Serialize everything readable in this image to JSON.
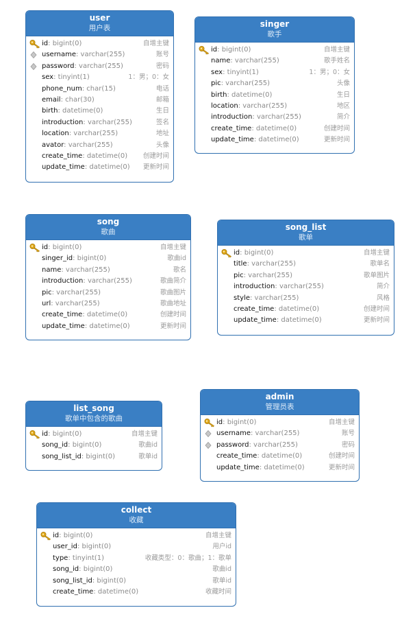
{
  "colors": {
    "header_bg": "#3a7fc4",
    "border": "#2f6fb0",
    "key_gold": "#e0a81a",
    "index_grey": "#b0b0b0"
  },
  "tables": {
    "user": {
      "name": "user",
      "desc": "用户表",
      "fields": [
        {
          "name": "id",
          "type": ": bigint(0)",
          "comment": "自增主键",
          "key": "primary"
        },
        {
          "name": "username",
          "type": ": varchar(255)",
          "comment": "账号",
          "key": "index"
        },
        {
          "name": "password",
          "type": ": varchar(255)",
          "comment": "密码",
          "key": "index"
        },
        {
          "name": "sex",
          "type": ": tinyint(1)",
          "comment": "1：男；0：女",
          "key": ""
        },
        {
          "name": "phone_num",
          "type": ": char(15)",
          "comment": "电话",
          "key": ""
        },
        {
          "name": "email",
          "type": ": char(30)",
          "comment": "邮箱",
          "key": ""
        },
        {
          "name": "birth",
          "type": ": datetime(0)",
          "comment": "生日",
          "key": ""
        },
        {
          "name": "introduction",
          "type": ": varchar(255)",
          "comment": "签名",
          "key": ""
        },
        {
          "name": "location",
          "type": ": varchar(255)",
          "comment": "地址",
          "key": ""
        },
        {
          "name": "avator",
          "type": ": varchar(255)",
          "comment": "头像",
          "key": ""
        },
        {
          "name": "create_time",
          "type": ": datetime(0)",
          "comment": "创建时间",
          "key": ""
        },
        {
          "name": "update_time",
          "type": ": datetime(0)",
          "comment": "更新时间",
          "key": ""
        }
      ]
    },
    "singer": {
      "name": "singer",
      "desc": "歌手",
      "fields": [
        {
          "name": "id",
          "type": ": bigint(0)",
          "comment": "自增主键",
          "key": "primary"
        },
        {
          "name": "name",
          "type": ": varchar(255)",
          "comment": "歌手姓名",
          "key": ""
        },
        {
          "name": "sex",
          "type": ": tinyint(1)",
          "comment": "1：男；0：女",
          "key": ""
        },
        {
          "name": "pic",
          "type": ": varchar(255)",
          "comment": "头像",
          "key": ""
        },
        {
          "name": "birth",
          "type": ": datetime(0)",
          "comment": "生日",
          "key": ""
        },
        {
          "name": "location",
          "type": ": varchar(255)",
          "comment": "地区",
          "key": ""
        },
        {
          "name": "introduction",
          "type": ": varchar(255)",
          "comment": "简介",
          "key": ""
        },
        {
          "name": "create_time",
          "type": ": datetime(0)",
          "comment": "创建时间",
          "key": ""
        },
        {
          "name": "update_time",
          "type": ": datetime(0)",
          "comment": "更新时间",
          "key": ""
        }
      ]
    },
    "song": {
      "name": "song",
      "desc": "歌曲",
      "fields": [
        {
          "name": "id",
          "type": ": bigint(0)",
          "comment": "自增主键",
          "key": "primary"
        },
        {
          "name": "singer_id",
          "type": ": bigint(0)",
          "comment": "歌曲id",
          "key": ""
        },
        {
          "name": "name",
          "type": ": varchar(255)",
          "comment": "歌名",
          "key": ""
        },
        {
          "name": "introduction",
          "type": ": varchar(255)",
          "comment": "歌曲简介",
          "key": ""
        },
        {
          "name": "pic",
          "type": ": varchar(255)",
          "comment": "歌曲图片",
          "key": ""
        },
        {
          "name": "url",
          "type": ": varchar(255)",
          "comment": "歌曲地址",
          "key": ""
        },
        {
          "name": "create_time",
          "type": ": datetime(0)",
          "comment": "创建时间",
          "key": ""
        },
        {
          "name": "update_time",
          "type": ": datetime(0)",
          "comment": "更新时间",
          "key": ""
        }
      ]
    },
    "song_list": {
      "name": "song_list",
      "desc": "歌单",
      "fields": [
        {
          "name": "id",
          "type": ": bigint(0)",
          "comment": "自增主键",
          "key": "primary"
        },
        {
          "name": "title",
          "type": ": varchar(255)",
          "comment": "歌单名",
          "key": ""
        },
        {
          "name": "pic",
          "type": ": varchar(255)",
          "comment": "歌单图片",
          "key": ""
        },
        {
          "name": "introduction",
          "type": ": varchar(255)",
          "comment": "简介",
          "key": ""
        },
        {
          "name": "style",
          "type": ": varchar(255)",
          "comment": "风格",
          "key": ""
        },
        {
          "name": "create_time",
          "type": ": datetime(0)",
          "comment": "创建时间",
          "key": ""
        },
        {
          "name": "update_time",
          "type": ": datetime(0)",
          "comment": "更新时间",
          "key": ""
        }
      ]
    },
    "list_song": {
      "name": "list_song",
      "desc": "歌单中包含的歌曲",
      "fields": [
        {
          "name": "id",
          "type": ": bigint(0)",
          "comment": "自增主键",
          "key": "primary"
        },
        {
          "name": "song_id",
          "type": ": bigint(0)",
          "comment": "歌曲id",
          "key": ""
        },
        {
          "name": "song_list_id",
          "type": ": bigint(0)",
          "comment": "歌单id",
          "key": ""
        }
      ]
    },
    "admin": {
      "name": "admin",
      "desc": "管理员表",
      "fields": [
        {
          "name": "id",
          "type": ": bigint(0)",
          "comment": "自增主键",
          "key": "primary"
        },
        {
          "name": "username",
          "type": ": varchar(255)",
          "comment": "账号",
          "key": "index"
        },
        {
          "name": "password",
          "type": ": varchar(255)",
          "comment": "密码",
          "key": "index"
        },
        {
          "name": "create_time",
          "type": ": datetime(0)",
          "comment": "创建时间",
          "key": ""
        },
        {
          "name": "update_time",
          "type": ": datetime(0)",
          "comment": "更新时间",
          "key": ""
        }
      ]
    },
    "collect": {
      "name": "collect",
      "desc": "收藏",
      "fields": [
        {
          "name": "id",
          "type": ": bigint(0)",
          "comment": "自增主键",
          "key": "primary"
        },
        {
          "name": "user_id",
          "type": ": bigint(0)",
          "comment": "用户id",
          "key": ""
        },
        {
          "name": "type",
          "type": ": tinyint(1)",
          "comment": "收藏类型：0：歌曲；1：歌单",
          "key": ""
        },
        {
          "name": "song_id",
          "type": ": bigint(0)",
          "comment": "歌曲id",
          "key": ""
        },
        {
          "name": "song_list_id",
          "type": ": bigint(0)",
          "comment": "歌单id",
          "key": ""
        },
        {
          "name": "create_time",
          "type": ": datetime(0)",
          "comment": "收藏时间",
          "key": ""
        }
      ]
    }
  }
}
